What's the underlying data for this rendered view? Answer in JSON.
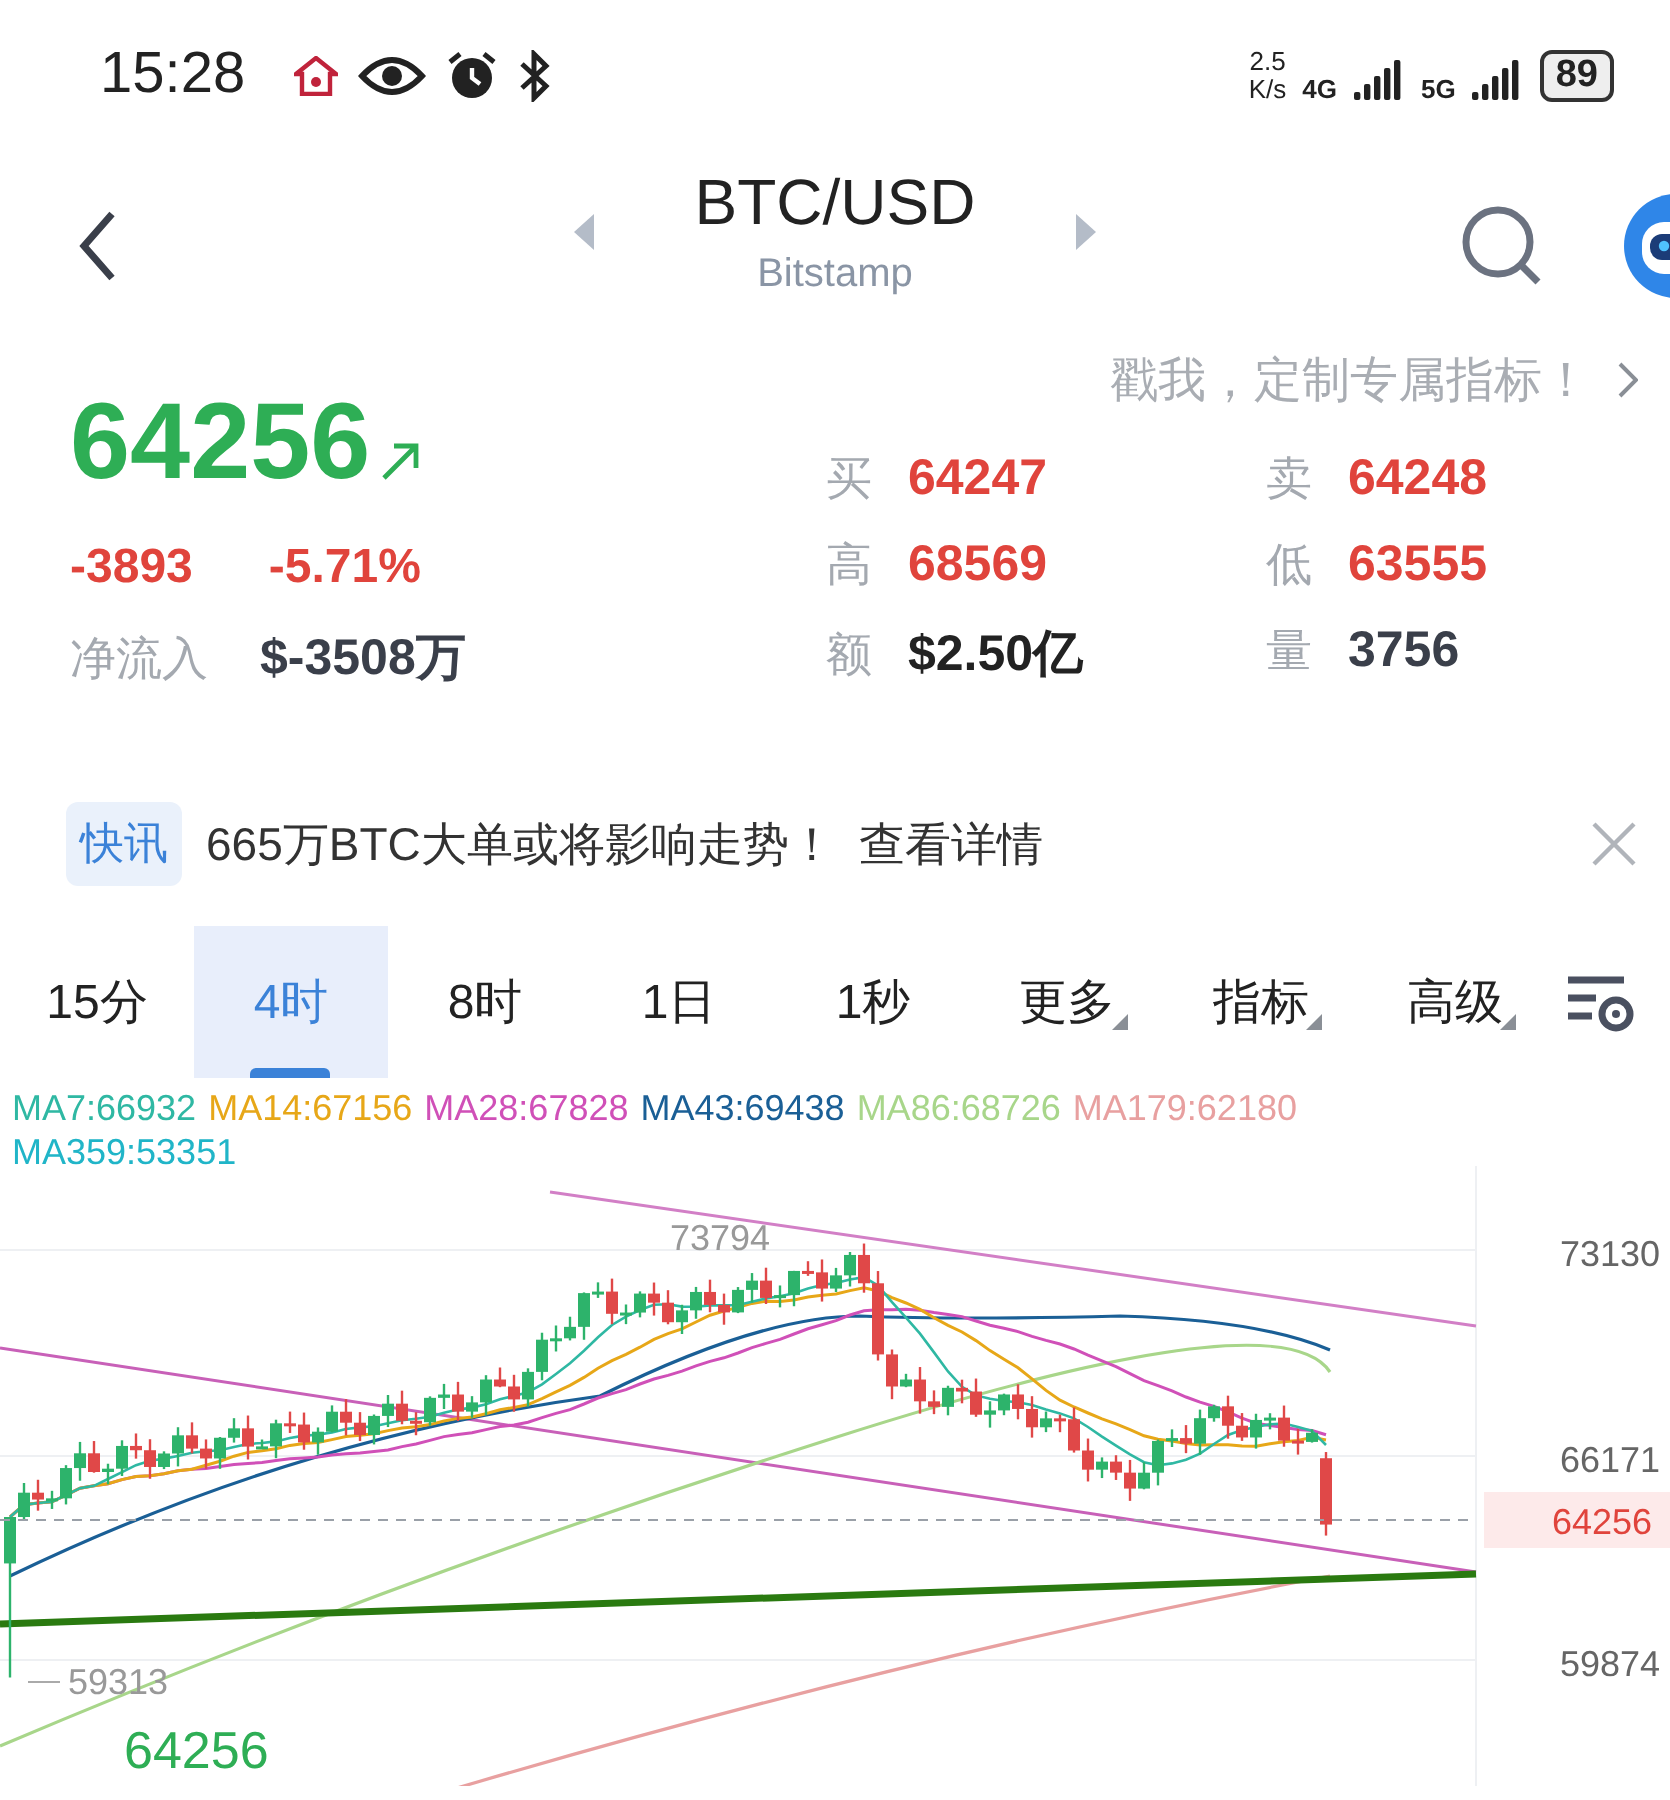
{
  "status_bar": {
    "time": "15:28",
    "net_speed": "2.5",
    "net_unit": "K/s",
    "sim1": "4G",
    "sim2": "5G",
    "battery": "89"
  },
  "header": {
    "title": "BTC/USD",
    "exchange": "Bitstamp"
  },
  "promo": {
    "text": "戳我，定制专属指标！"
  },
  "quote": {
    "price": "64256",
    "change": "-3893",
    "change_pct": "-5.71%",
    "net_inflow_label": "净流入",
    "net_inflow": "$-3508万"
  },
  "stats": [
    {
      "label": "买",
      "value": "64247",
      "color": "#e0443c"
    },
    {
      "label": "卖",
      "value": "64248",
      "color": "#e0443c"
    },
    {
      "label": "高",
      "value": "68569",
      "color": "#e0443c"
    },
    {
      "label": "低",
      "value": "63555",
      "color": "#e0443c"
    },
    {
      "label": "额",
      "value": "$2.50亿",
      "color": "#222222"
    },
    {
      "label": "量",
      "value": "3756",
      "color": "#3a3f4a"
    }
  ],
  "news": {
    "tag": "快讯",
    "headline": "665万BTC大单或将影响走势！",
    "link": "查看详情"
  },
  "tabs": [
    {
      "label": "15分",
      "selected": false,
      "dropdown": false
    },
    {
      "label": "4时",
      "selected": true,
      "dropdown": false
    },
    {
      "label": "8时",
      "selected": false,
      "dropdown": false
    },
    {
      "label": "1日",
      "selected": false,
      "dropdown": false
    },
    {
      "label": "1秒",
      "selected": false,
      "dropdown": false
    },
    {
      "label": "更多",
      "selected": false,
      "dropdown": true
    },
    {
      "label": "指标",
      "selected": false,
      "dropdown": true
    },
    {
      "label": "高级",
      "selected": false,
      "dropdown": true
    }
  ],
  "chart": {
    "ma_legend": [
      {
        "label": "MA7:66932",
        "color": "#2fb8a3"
      },
      {
        "label": "MA14:67156",
        "color": "#e7a718"
      },
      {
        "label": "MA28:67828",
        "color": "#d050b8"
      },
      {
        "label": "MA43:69438",
        "color": "#1a5f96"
      },
      {
        "label": "MA86:68726",
        "color": "#a8d68a"
      },
      {
        "label": "MA179:62180",
        "color": "#e8a0a0"
      },
      {
        "label": "MA359:53351",
        "color": "#20b5c8"
      }
    ],
    "price_ticks": [
      "73130",
      "66171",
      "59874"
    ],
    "current_price": "64256",
    "high_marker": "73794",
    "low_marker": "59313",
    "last_price": "64256"
  }
}
